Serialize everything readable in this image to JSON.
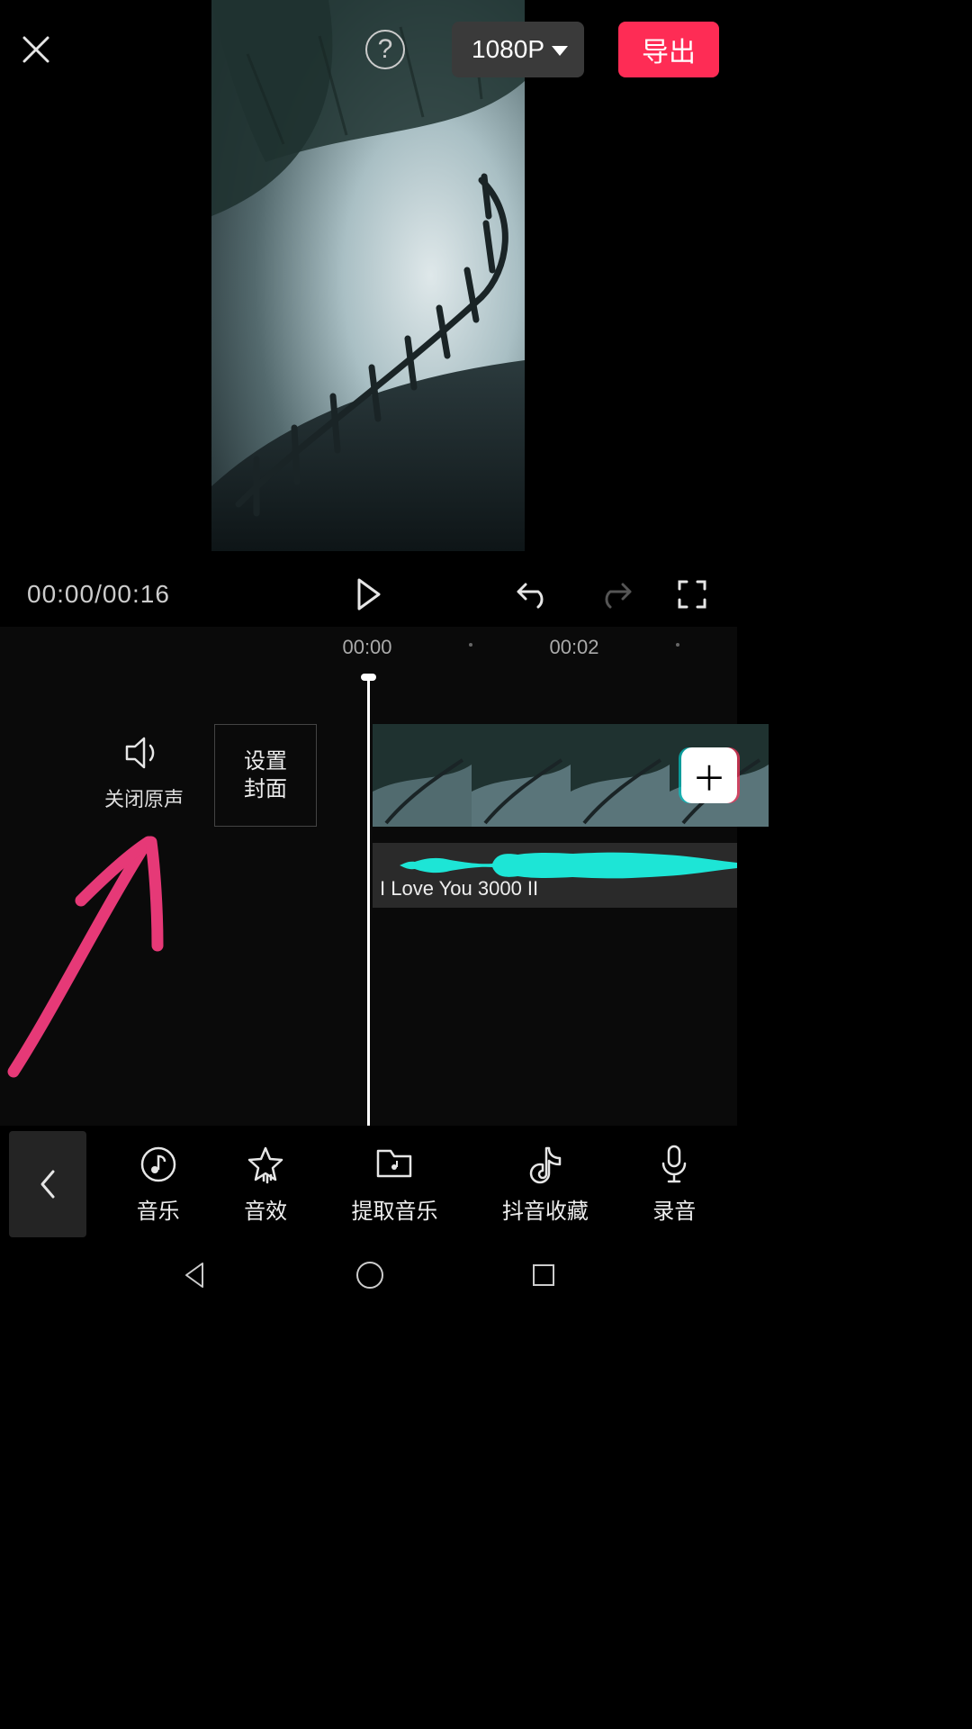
{
  "topbar": {
    "help_glyph": "?",
    "resolution_label": "1080P",
    "export_label": "导出"
  },
  "playbar": {
    "current_time": "00:00",
    "total_time": "00:16"
  },
  "ruler": {
    "marks": [
      "00:00",
      "00:02"
    ]
  },
  "mute": {
    "label": "关闭原声"
  },
  "cover": {
    "label_line1": "设置",
    "label_line2": "封面"
  },
  "audio_track": {
    "title": "I Love You 3000 II"
  },
  "add_clip": {
    "glyph": "＋"
  },
  "tools": {
    "items": [
      {
        "icon": "music",
        "label": "音乐"
      },
      {
        "icon": "sfx",
        "label": "音效"
      },
      {
        "icon": "extract",
        "label": "提取音乐"
      },
      {
        "icon": "douyin",
        "label": "抖音收藏"
      },
      {
        "icon": "record",
        "label": "录音"
      }
    ]
  }
}
